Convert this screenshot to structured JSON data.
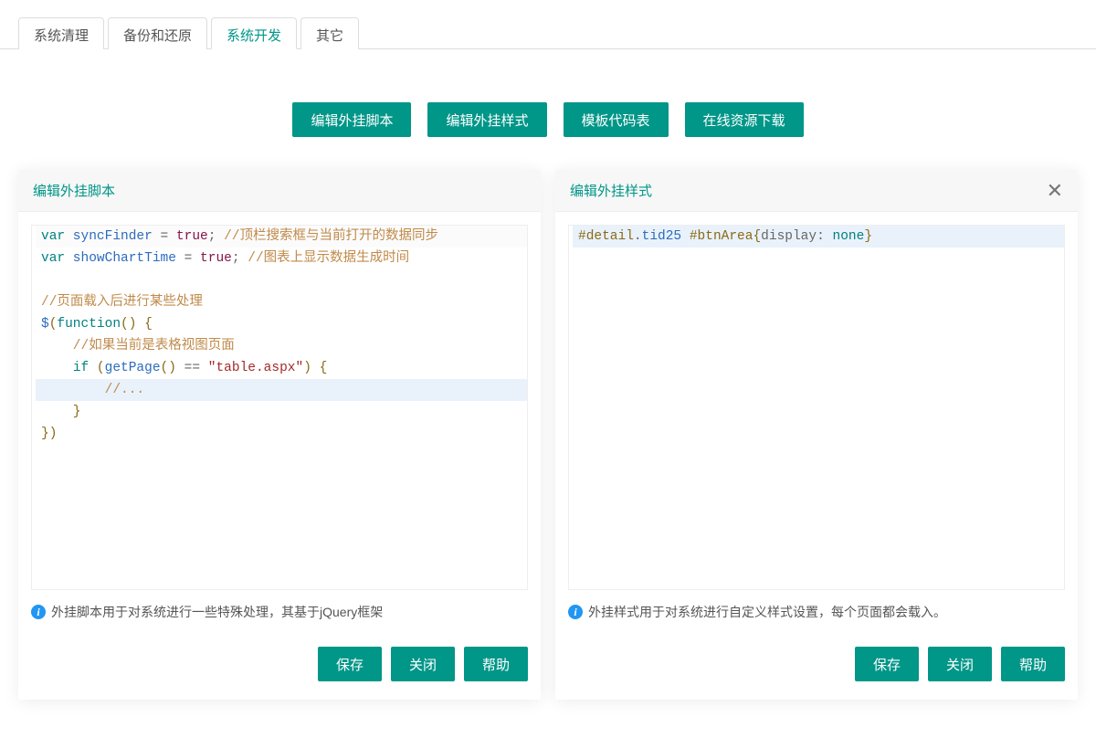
{
  "tabs": [
    {
      "label": "系统清理",
      "active": false
    },
    {
      "label": "备份和还原",
      "active": false
    },
    {
      "label": "系统开发",
      "active": true
    },
    {
      "label": "其它",
      "active": false
    }
  ],
  "toolbar": {
    "edit_script": "编辑外挂脚本",
    "edit_style": "编辑外挂样式",
    "template_table": "模板代码表",
    "online_download": "在线资源下载"
  },
  "panel_script": {
    "title": "编辑外挂脚本",
    "info": "外挂脚本用于对系统进行一些特殊处理，其基于jQuery框架",
    "code": {
      "l1_var": "var",
      "l1_name": " syncFinder ",
      "l1_eq": "= ",
      "l1_val": "true",
      "l1_semi": "; ",
      "l1_cmt": "//顶栏搜索框与当前打开的数据同步",
      "l2_var": "var",
      "l2_name": " showChartTime ",
      "l2_eq": "= ",
      "l2_val": "true",
      "l2_semi": "; ",
      "l2_cmt": "//图表上显示数据生成时间",
      "l4_cmt": "//页面载入后进行某些处理",
      "l5_dollar": "$",
      "l5_open": "(",
      "l5_fn": "function",
      "l5_parens": "()",
      "l5_brace": " {",
      "l6_cmt": "    //如果当前是表格视图页面",
      "l7_indent": "    ",
      "l7_if": "if",
      "l7_open": " (",
      "l7_get": "getPage",
      "l7_call": "()",
      "l7_eq": " == ",
      "l7_q1": "\"",
      "l7_str": "table.aspx",
      "l7_q2": "\"",
      "l7_close": ")",
      "l7_brace": " {",
      "l8_cmt": "        //...",
      "l9_close": "    }",
      "l10_close": "})"
    },
    "save": "保存",
    "close": "关闭",
    "help": "帮助"
  },
  "panel_style": {
    "title": "编辑外挂样式",
    "info": "外挂样式用于对系统进行自定义样式设置，每个页面都会载入。",
    "code": {
      "sel_hash1": "#detail",
      "sel_dot": ".",
      "sel_class": "tid25",
      "sel_sp": " ",
      "sel_hash2": "#btnArea",
      "brace_o": "{",
      "prop": "display",
      "colon": ": ",
      "val": "none",
      "brace_c": "}"
    },
    "save": "保存",
    "close": "关闭",
    "help": "帮助"
  }
}
